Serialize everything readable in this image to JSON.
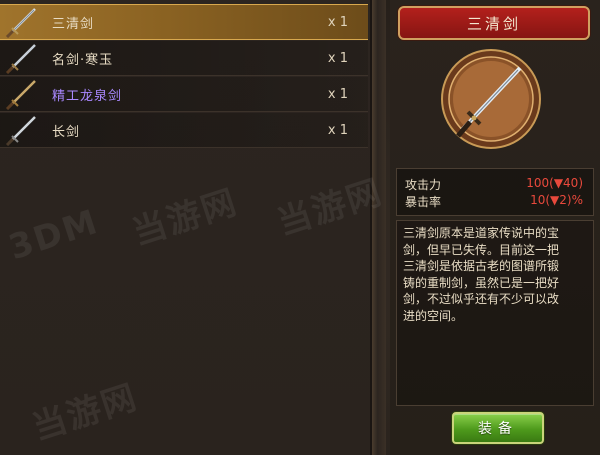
{
  "items": [
    {
      "name": "三清剑",
      "qty": "x 1",
      "selected": true,
      "rarity": "normal"
    },
    {
      "name": "名剑·寒玉",
      "qty": "x 1",
      "selected": false,
      "rarity": "normal"
    },
    {
      "name": "精工龙泉剑",
      "qty": "x 1",
      "selected": false,
      "rarity": "purple"
    },
    {
      "name": "长剑",
      "qty": "x 1",
      "selected": false,
      "rarity": "normal"
    }
  ],
  "detail": {
    "title": "三清剑",
    "stats": [
      {
        "label": "攻击力",
        "value": "100(▼40)"
      },
      {
        "label": "暴击率",
        "value": "10(▼2)%"
      }
    ],
    "description_lines": [
      "三清剑原本是道家传说中的宝",
      "剑，但早已失传。目前这一把",
      "三清剑是依据古老的图谱所锻",
      "铸的重制剑，虽然已是一把好",
      "剑，不过似乎还有不少可以改",
      "进的空间。"
    ],
    "equip_label": "装备"
  },
  "watermark": {
    "logo": "3DM",
    "text": "当游网"
  },
  "colors": {
    "stat_value": "#e8493c",
    "purple_item": "#a988ff",
    "selected_row": "#a0742c",
    "title_banner": "#b3201c",
    "equip_button": "#5aa822"
  }
}
